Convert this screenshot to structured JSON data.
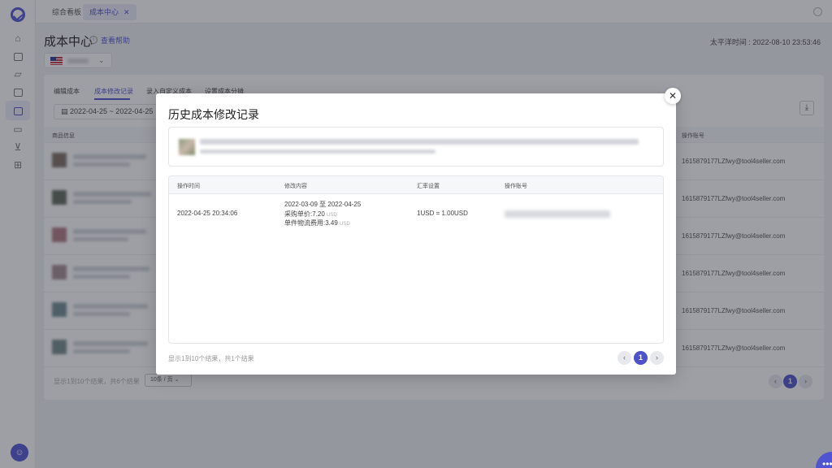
{
  "topbar": {
    "tabs": [
      {
        "label": "综合看板"
      },
      {
        "label": "成本中心",
        "close": "✕"
      }
    ]
  },
  "page": {
    "title": "成本中心",
    "help_link": "查看帮助",
    "timezone_label": "太平洋时间",
    "datetime": "2022-08-10 23:53:46"
  },
  "subtabs": [
    "编辑成本",
    "成本修改记录",
    "录入自定义成本",
    "设置成本分摊"
  ],
  "date_range": "2022-04-25 ~ 2022-04-25",
  "bg_table": {
    "headers": [
      "商品信息",
      "操作账号"
    ],
    "accounts": [
      "1615879177LZfwy@tool4seller.com",
      "1615879177LZfwy@tool4seller.com",
      "1615879177LZfwy@tool4seller.com",
      "1615879177LZfwy@tool4seller.com",
      "1615879177LZfwy@tool4seller.com",
      "1615879177LZfwy@tool4seller.com"
    ],
    "footer": "显示1到10个结果，共6个结果",
    "page_size": "10条 / 页",
    "current_page": "1"
  },
  "modal": {
    "title": "历史成本修改记录",
    "close_label": "✕",
    "headers": [
      "操作时间",
      "修改内容",
      "汇率设置",
      "操作账号"
    ],
    "row": {
      "time": "2022-04-25 20:34:06",
      "period": "2022-03-09 至 2022-04-25",
      "purchase_label": "采购单价:7.20",
      "shipping_label": "单件物流费用:3.49",
      "unit": "USD",
      "rate": "1USD = 1.00USD"
    },
    "footer": "显示1到10个结果，共1个结果",
    "current_page": "1"
  },
  "colors": {
    "accent": "#4f52c9"
  }
}
